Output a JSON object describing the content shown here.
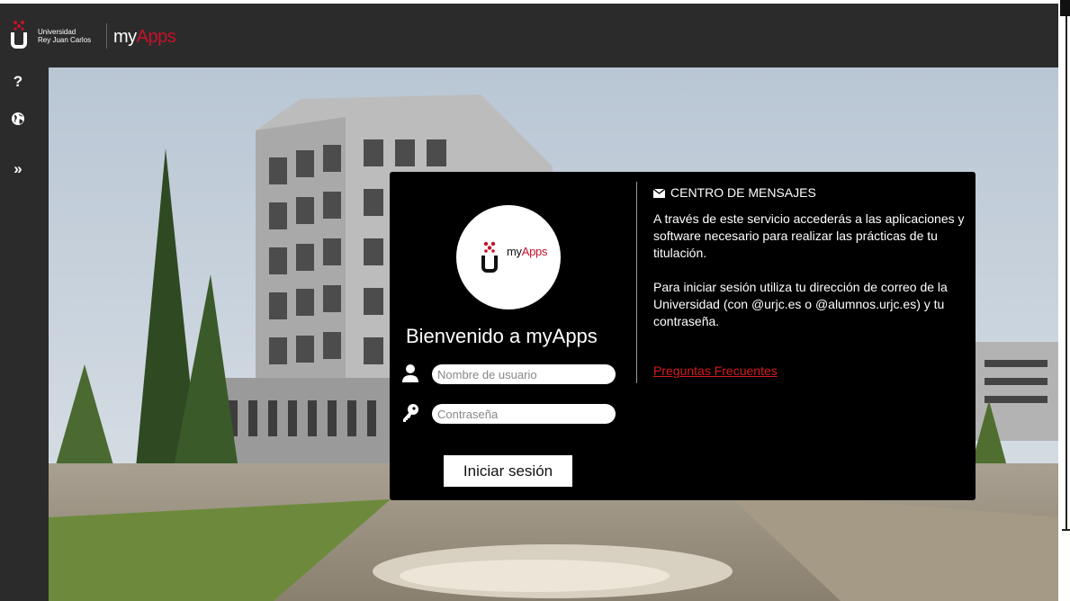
{
  "header": {
    "university_line1": "Universidad",
    "university_line2": "Rey Juan Carlos",
    "brand_my": "my",
    "brand_apps": "Apps"
  },
  "sidebar": {
    "items": [
      {
        "icon": "question-icon",
        "glyph": "?"
      },
      {
        "icon": "globe-icon",
        "glyph": "🌐"
      },
      {
        "icon": "expand-icon",
        "glyph": "»"
      }
    ]
  },
  "login": {
    "avatar_my": "my",
    "avatar_apps": "Apps",
    "welcome": "Bienvenido a myApps",
    "username_placeholder": "Nombre de usuario",
    "password_placeholder": "Contraseña",
    "submit_label": "Iniciar sesión"
  },
  "messages": {
    "title": "CENTRO DE MENSAJES",
    "paragraph1": "A través de este servicio accederás a las aplicaciones y software necesario para realizar las prácticas de tu titulación.",
    "paragraph2": "Para iniciar sesión utiliza tu dirección de correo de la Universidad (con @urjc.es o @alumnos.urjc.es) y tu contraseña.",
    "faq_link": "Preguntas Frecuentes"
  },
  "colors": {
    "brand_red": "#c7112b",
    "link_red": "#d71a1a",
    "dark_bar": "#2b2b2b",
    "panel": "#000000"
  }
}
